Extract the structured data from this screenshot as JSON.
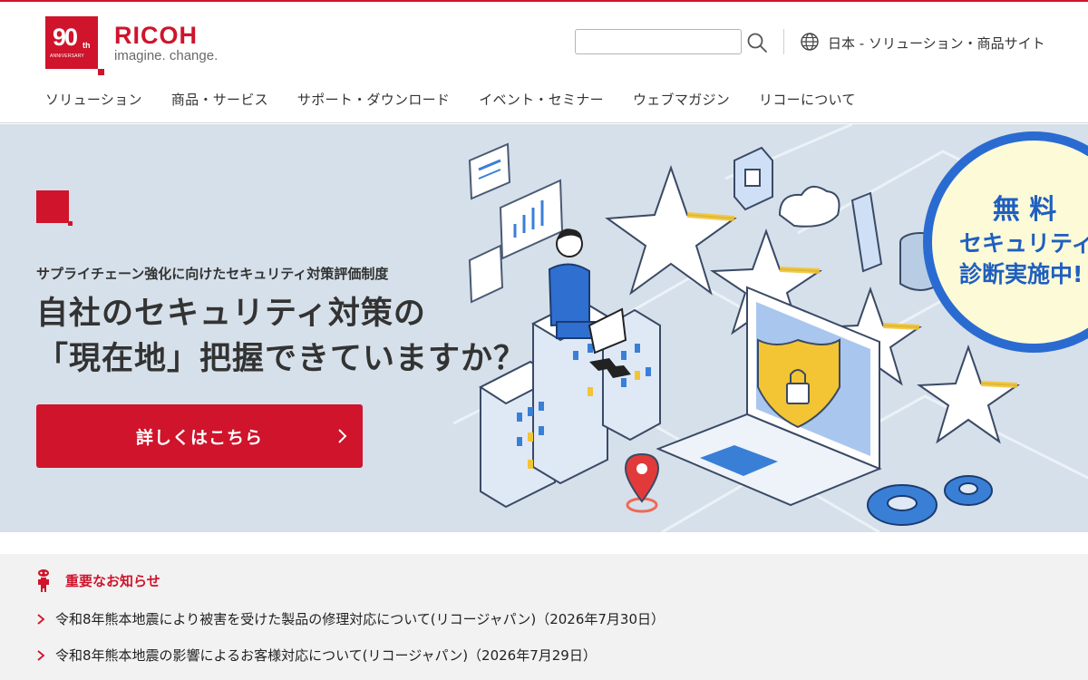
{
  "header": {
    "logo": {
      "anniversary_number": "90",
      "anniversary_suffix": "th",
      "anniversary_word": "ANNIVERSARY",
      "brand": "RICOH",
      "tagline": "imagine. change."
    },
    "search": {
      "placeholder": "",
      "value": ""
    },
    "region_link": "日本 - ソリューション・商品サイト"
  },
  "nav": {
    "items": [
      "ソリューション",
      "商品・サービス",
      "サポート・ダウンロード",
      "イベント・セミナー",
      "ウェブマガジン",
      "リコーについて"
    ]
  },
  "hero": {
    "subtitle": "サプライチェーン強化に向けたセキュリティ対策評価制度",
    "title_line1": "自社のセキュリティ対策の",
    "title_line2": "「現在地」把握できていますか？",
    "cta_label": "詳しくはこちら",
    "badge_line1": "無 料",
    "badge_line2": "セキュリティ",
    "badge_line3": "診断実施中!"
  },
  "notices": {
    "heading": "重要なお知らせ",
    "items": [
      "令和8年熊本地震により被害を受けた製品の修理対応について(リコージャパン)（2026年7月30日）",
      "令和8年熊本地震の影響によるお客様対応について(リコージャパン)（2026年7月29日）"
    ]
  },
  "colors": {
    "brand_red": "#cf142b",
    "hero_bg": "#d6e0ea",
    "notice_bg": "#f2f2f2",
    "badge_blue": "#1f5fc0"
  }
}
